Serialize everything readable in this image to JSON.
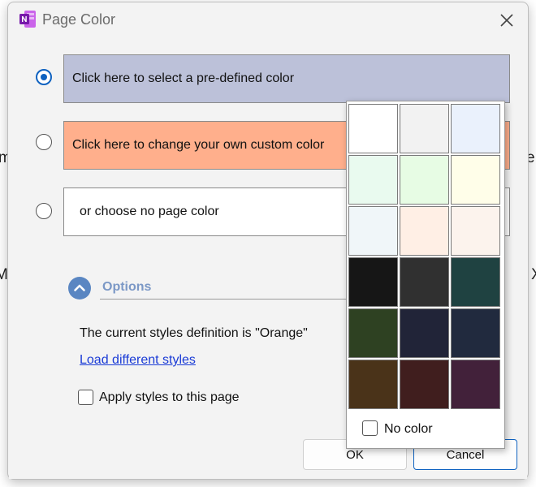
{
  "window": {
    "title": "Page Color"
  },
  "choices": {
    "predefined": {
      "label": "Click here to select a pre-defined color",
      "color": "#bcc1d9",
      "selected": true
    },
    "custom": {
      "label": "Click here to change your own custom color",
      "color": "#ffaf8c"
    },
    "none": {
      "label": "or choose no page color",
      "color": "#ffffff"
    }
  },
  "options": {
    "header": "Options",
    "styles_text": "The current styles definition is \"Orange\"",
    "load_styles": "Load different styles",
    "apply_label": "Apply styles to this page"
  },
  "buttons": {
    "ok": "OK",
    "cancel": "Cancel"
  },
  "palette": {
    "colors": [
      "#ffffff",
      "#f2f2f2",
      "#eaf1fc",
      "#e9faef",
      "#e7fce4",
      "#fffee9",
      "#f0f6f9",
      "#ffefe5",
      "#fcf3ed",
      "#161616",
      "#303030",
      "#1f4241",
      "#2e4122",
      "#212438",
      "#212a3e",
      "#4a3319",
      "#401e1e",
      "#42213a"
    ],
    "no_color_label": "No color"
  },
  "background_fragments": {
    "left_1": "m",
    "right_1": "e",
    "left_2": "MI",
    "right_2": "X"
  }
}
